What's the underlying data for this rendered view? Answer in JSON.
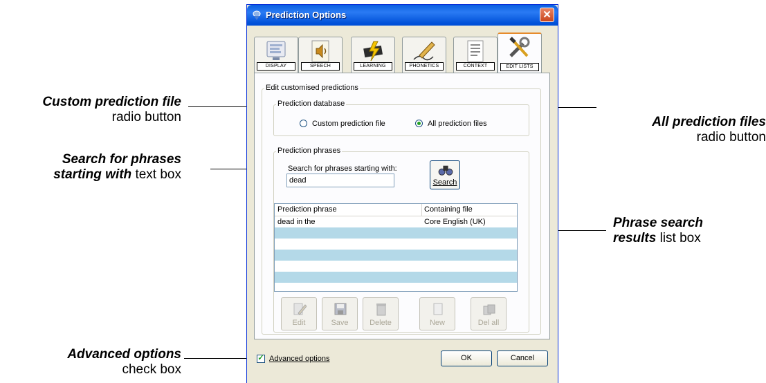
{
  "window": {
    "title": "Prediction Options",
    "close_label": "✕"
  },
  "tabs": [
    {
      "label": "DISPLAY"
    },
    {
      "label": "SPEECH"
    },
    {
      "label": "LEARNING"
    },
    {
      "label": "PHONETICS"
    },
    {
      "label": "CONTEXT"
    },
    {
      "label": "EDIT LISTS",
      "active": true
    }
  ],
  "edit_group": {
    "title": "Edit customised predictions"
  },
  "database_group": {
    "title": "Prediction database",
    "options": [
      {
        "label": "Custom prediction file",
        "selected": false
      },
      {
        "label": "All prediction files",
        "selected": true
      }
    ]
  },
  "phrases_group": {
    "title": "Prediction phrases",
    "search_label": "Search for phrases starting with:",
    "search_value": "dead",
    "search_button": "Search"
  },
  "results": {
    "columns": [
      "Prediction phrase",
      "Containing file"
    ],
    "rows": [
      {
        "phrase": "dead in the",
        "file": "Core English (UK)"
      },
      {
        "phrase": "",
        "file": ""
      },
      {
        "phrase": "",
        "file": ""
      },
      {
        "phrase": "",
        "file": ""
      },
      {
        "phrase": "",
        "file": ""
      },
      {
        "phrase": "",
        "file": ""
      },
      {
        "phrase": "",
        "file": ""
      }
    ]
  },
  "action_buttons": [
    {
      "label": "Edit",
      "icon": "pencil-icon"
    },
    {
      "label": "Save",
      "icon": "floppy-disk-icon"
    },
    {
      "label": "Delete",
      "icon": "trash-icon"
    },
    {
      "label": "New",
      "icon": "new-document-icon"
    },
    {
      "label": "Del all",
      "icon": "trash-all-icon"
    }
  ],
  "footer": {
    "advanced_label": "Advanced options",
    "advanced_checked": true,
    "ok_label": "OK",
    "cancel_label": "Cancel"
  },
  "callouts": {
    "custom_file": {
      "bold": "Custom prediction file",
      "rest": "radio button"
    },
    "search_phrases": {
      "bold1": "Search for phrases",
      "bold2": "starting with",
      "rest": " text box"
    },
    "advanced": {
      "bold": "Advanced options",
      "rest": "check box"
    },
    "all_files": {
      "bold": "All prediction files",
      "rest": "radio button"
    },
    "results": {
      "bold1": "Phrase search",
      "bold2": "results",
      "rest": " list box"
    }
  },
  "colors": {
    "titlebar": "#0a5fe0",
    "list_alt_row": "#b4d9e8",
    "active_tab_accent": "#e68b2c"
  }
}
